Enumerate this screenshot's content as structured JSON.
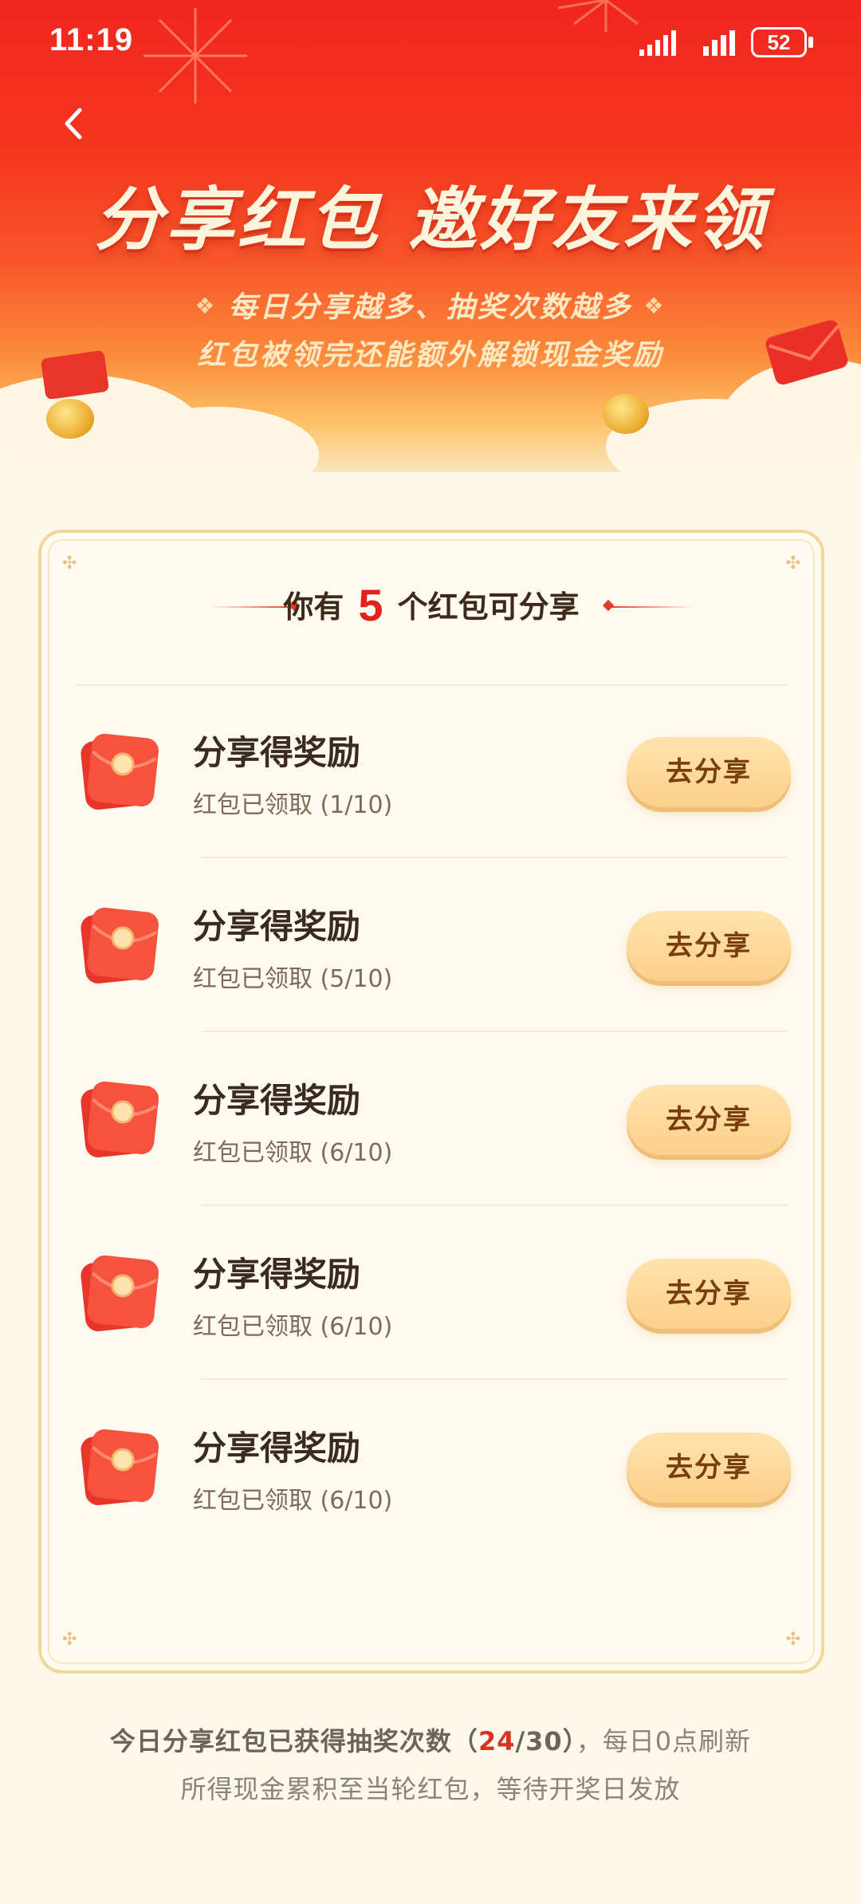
{
  "status_bar": {
    "time": "11:19",
    "battery": "52"
  },
  "hero": {
    "title": "分享红包 邀好友来领",
    "subtitle_1": "每日分享越多、抽奖次数越多",
    "subtitle_2": "红包被领完还能额外解锁现金奖励"
  },
  "card": {
    "heading_prefix": "你有",
    "heading_count": "5",
    "heading_suffix": "个红包可分享",
    "items": [
      {
        "title": "分享得奖励",
        "status": "红包已领取 (1/10)",
        "button": "去分享"
      },
      {
        "title": "分享得奖励",
        "status": "红包已领取 (5/10)",
        "button": "去分享"
      },
      {
        "title": "分享得奖励",
        "status": "红包已领取 (6/10)",
        "button": "去分享"
      },
      {
        "title": "分享得奖励",
        "status": "红包已领取 (6/10)",
        "button": "去分享"
      },
      {
        "title": "分享得奖励",
        "status": "红包已领取 (6/10)",
        "button": "去分享"
      }
    ]
  },
  "footer": {
    "line1_prefix": "今日分享红包已获得抽奖次数（",
    "line1_count": "24",
    "line1_total": "/30）",
    "line1_suffix": "，每日0点刷新",
    "line2": "所得现金累积至当轮红包，等待开奖日发放"
  },
  "colors": {
    "accent": "#e8201b",
    "button": "#fcd08a",
    "header_red": "#f0261f"
  }
}
